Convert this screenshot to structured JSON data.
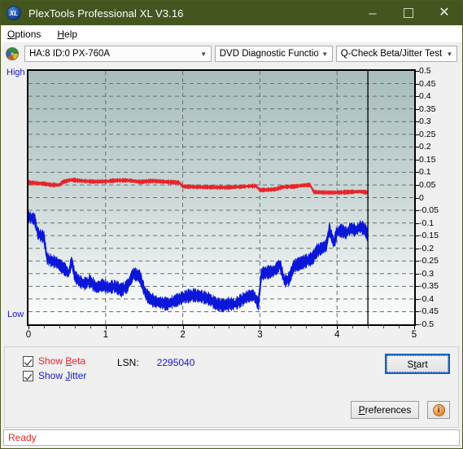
{
  "window": {
    "title": "PlexTools Professional XL V3.16",
    "app_icon": "xl-disc-icon",
    "minimize_label": "─",
    "maximize_label": "",
    "close_label": "✕",
    "titlebar_color": "#44561f"
  },
  "menubar": {
    "items": [
      {
        "label": "Options"
      },
      {
        "label": "Help"
      }
    ]
  },
  "toolbar": {
    "drive_icon": "cd-disc-icon",
    "drive": {
      "value": "HA:8 ID:0  PX-760A"
    },
    "function": {
      "value": "DVD Diagnostic Functions"
    },
    "test": {
      "value": "Q-Check Beta/Jitter Test"
    },
    "arrow": "⌄"
  },
  "chart_labels": {
    "high": "High",
    "low": "Low"
  },
  "controls": {
    "show_beta": {
      "label_pre": "Show ",
      "label_key": "B",
      "label_post": "eta",
      "checked": true,
      "color": "#e8252a"
    },
    "show_jitter": {
      "label_pre": "Show ",
      "label_key": "J",
      "label_post": "itter",
      "checked": true,
      "color": "#1717d0"
    },
    "lsn_key": "LSN:",
    "lsn_value": "2295040",
    "start_pre": "S",
    "start_key": "t",
    "start_post": "art",
    "preferences_pre": "P",
    "preferences_key": "",
    "preferences_post": "references",
    "info_glyph": "i"
  },
  "statusbar": {
    "text": "Ready"
  },
  "chart_data": {
    "type": "line",
    "title": "Q-Check Beta/Jitter Test",
    "xlabel": "",
    "ylabel": "",
    "xlim": [
      0,
      5
    ],
    "ylim": [
      -0.5,
      0.5
    ],
    "xticks": [
      0,
      1,
      2,
      3,
      4,
      5
    ],
    "yticks": [
      0.5,
      0.45,
      0.4,
      0.35,
      0.3,
      0.25,
      0.2,
      0.15,
      0.1,
      0.05,
      0,
      -0.05,
      -0.1,
      -0.15,
      -0.2,
      -0.25,
      -0.3,
      -0.35,
      -0.4,
      -0.45,
      -0.5
    ],
    "ytick_labels": [
      "0.5",
      "0.45",
      "0.4",
      "0.35",
      "0.3",
      "0.25",
      "0.2",
      "0.15",
      "0.1",
      "0.05",
      "0",
      "-0.05",
      "-0.1",
      "-0.15",
      "-0.2",
      "-0.25",
      "-0.3",
      "-0.35",
      "-0.4",
      "-0.45",
      "-0.5"
    ],
    "grid": true,
    "grid_style": "dashed",
    "grid_color": "#6a7070",
    "legend_position": "bottom-left",
    "cursor_x": 4.4,
    "series": [
      {
        "name": "Beta",
        "color": "#e8252a",
        "noise": 0.007,
        "points": [
          [
            0.0,
            0.06
          ],
          [
            0.1,
            0.057
          ],
          [
            0.2,
            0.055
          ],
          [
            0.3,
            0.05
          ],
          [
            0.4,
            0.05
          ],
          [
            0.45,
            0.062
          ],
          [
            0.55,
            0.07
          ],
          [
            0.7,
            0.066
          ],
          [
            0.85,
            0.063
          ],
          [
            1.0,
            0.064
          ],
          [
            1.15,
            0.068
          ],
          [
            1.3,
            0.068
          ],
          [
            1.45,
            0.062
          ],
          [
            1.6,
            0.066
          ],
          [
            1.7,
            0.064
          ],
          [
            1.8,
            0.062
          ],
          [
            1.9,
            0.06
          ],
          [
            1.95,
            0.06
          ],
          [
            2.0,
            0.044
          ],
          [
            2.2,
            0.042
          ],
          [
            2.4,
            0.041
          ],
          [
            2.55,
            0.04
          ],
          [
            2.7,
            0.042
          ],
          [
            2.85,
            0.045
          ],
          [
            2.95,
            0.046
          ],
          [
            3.0,
            0.03
          ],
          [
            3.1,
            0.031
          ],
          [
            3.2,
            0.033
          ],
          [
            3.3,
            0.042
          ],
          [
            3.45,
            0.044
          ],
          [
            3.55,
            0.048
          ],
          [
            3.65,
            0.05
          ],
          [
            3.7,
            0.022
          ],
          [
            3.85,
            0.02
          ],
          [
            4.0,
            0.02
          ],
          [
            4.15,
            0.022
          ],
          [
            4.3,
            0.024
          ],
          [
            4.4,
            0.02
          ]
        ]
      },
      {
        "name": "Jitter",
        "color": "#0a16d8",
        "noise": 0.022,
        "points": [
          [
            0.0,
            -0.075
          ],
          [
            0.04,
            -0.08
          ],
          [
            0.08,
            -0.085
          ],
          [
            0.12,
            -0.14
          ],
          [
            0.16,
            -0.15
          ],
          [
            0.2,
            -0.155
          ],
          [
            0.24,
            -0.24
          ],
          [
            0.3,
            -0.25
          ],
          [
            0.36,
            -0.255
          ],
          [
            0.42,
            -0.27
          ],
          [
            0.48,
            -0.285
          ],
          [
            0.52,
            -0.3
          ],
          [
            0.56,
            -0.25
          ],
          [
            0.6,
            -0.31
          ],
          [
            0.66,
            -0.33
          ],
          [
            0.72,
            -0.34
          ],
          [
            0.8,
            -0.33
          ],
          [
            0.88,
            -0.355
          ],
          [
            0.96,
            -0.345
          ],
          [
            1.04,
            -0.355
          ],
          [
            1.12,
            -0.35
          ],
          [
            1.2,
            -0.365
          ],
          [
            1.28,
            -0.35
          ],
          [
            1.36,
            -0.3
          ],
          [
            1.44,
            -0.31
          ],
          [
            1.52,
            -0.38
          ],
          [
            1.58,
            -0.4
          ],
          [
            1.64,
            -0.41
          ],
          [
            1.72,
            -0.415
          ],
          [
            1.8,
            -0.42
          ],
          [
            1.88,
            -0.41
          ],
          [
            1.96,
            -0.4
          ],
          [
            2.04,
            -0.39
          ],
          [
            2.14,
            -0.385
          ],
          [
            2.24,
            -0.39
          ],
          [
            2.34,
            -0.4
          ],
          [
            2.44,
            -0.42
          ],
          [
            2.52,
            -0.425
          ],
          [
            2.6,
            -0.42
          ],
          [
            2.68,
            -0.42
          ],
          [
            2.76,
            -0.405
          ],
          [
            2.84,
            -0.39
          ],
          [
            2.92,
            -0.385
          ],
          [
            2.98,
            -0.42
          ],
          [
            3.02,
            -0.3
          ],
          [
            3.1,
            -0.295
          ],
          [
            3.18,
            -0.29
          ],
          [
            3.26,
            -0.265
          ],
          [
            3.32,
            -0.33
          ],
          [
            3.38,
            -0.32
          ],
          [
            3.44,
            -0.27
          ],
          [
            3.52,
            -0.26
          ],
          [
            3.6,
            -0.25
          ],
          [
            3.68,
            -0.24
          ],
          [
            3.74,
            -0.21
          ],
          [
            3.8,
            -0.2
          ],
          [
            3.86,
            -0.19
          ],
          [
            3.9,
            -0.125
          ],
          [
            3.96,
            -0.18
          ],
          [
            4.0,
            -0.135
          ],
          [
            4.06,
            -0.13
          ],
          [
            4.12,
            -0.14
          ],
          [
            4.18,
            -0.12
          ],
          [
            4.24,
            -0.13
          ],
          [
            4.3,
            -0.115
          ],
          [
            4.36,
            -0.125
          ],
          [
            4.4,
            -0.15
          ]
        ]
      }
    ]
  }
}
